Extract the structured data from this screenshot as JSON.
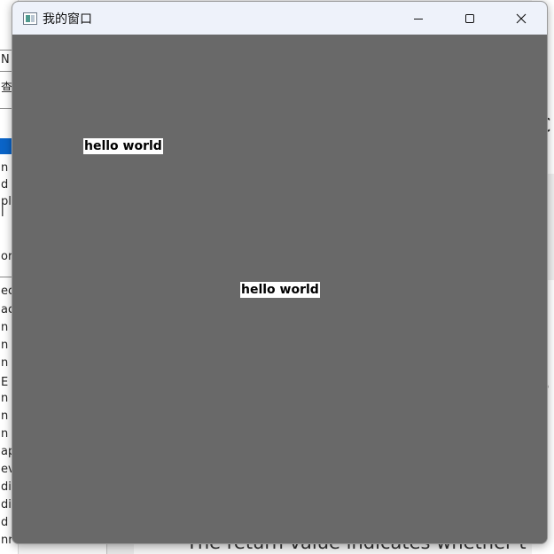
{
  "window": {
    "title": "我的窗口",
    "icon": "app-window-icon",
    "client_background": "#696969",
    "titlebar_background": "#eef2fa"
  },
  "caption_buttons": {
    "minimize": "minimize-icon",
    "maximize": "maximize-icon",
    "close": "close-icon"
  },
  "content": {
    "labels": [
      {
        "text": "hello world"
      },
      {
        "text": "hello world"
      }
    ],
    "label_background": "#ffffff",
    "label_color": "#000000"
  },
  "background_window": {
    "left_fragments": [
      "N",
      "查",
      "n",
      "d",
      "pl",
      "l",
      "or",
      "ec",
      "ac",
      "n",
      "n",
      "n",
      "E",
      "n",
      "n",
      "n",
      "ap",
      "ev",
      "di",
      "di",
      "d",
      "nr"
    ],
    "right_fragments": [
      "C",
      "c",
      "e",
      "a",
      "e"
    ],
    "bottom_text": "The return value indicates whether t"
  }
}
